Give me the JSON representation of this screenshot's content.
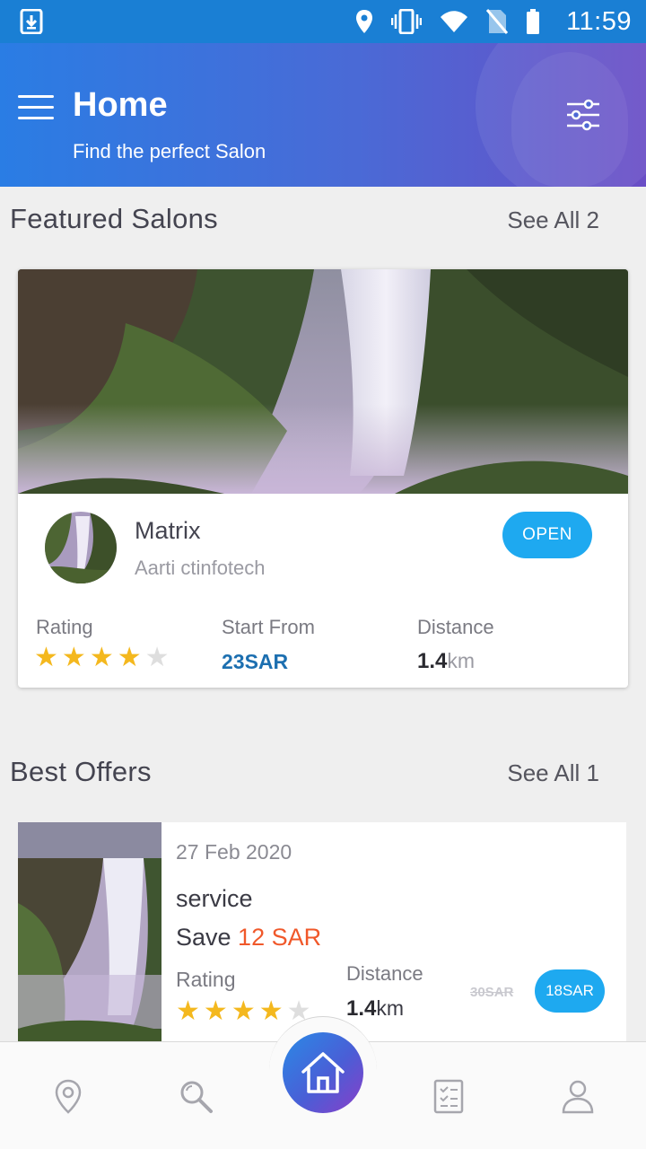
{
  "status_bar": {
    "time": "11:59"
  },
  "header": {
    "title": "Home",
    "subtitle": "Find the perfect Salon",
    "icons": [
      "menu-icon",
      "filter-sliders-icon"
    ]
  },
  "featured": {
    "section_title": "Featured Salons",
    "see_all": "See All 2",
    "salon": {
      "name": "Matrix",
      "owner": "Aarti ctinfotech",
      "status": "OPEN",
      "rating_label": "Rating",
      "rating": 4,
      "rating_max": 5,
      "start_label": "Start From",
      "start_price": "23SAR",
      "distance_label": "Distance",
      "distance_value": "1.4",
      "distance_unit": "km"
    }
  },
  "offers": {
    "section_title": "Best Offers",
    "see_all": "See All 1",
    "items": [
      {
        "date": "27 Feb 2020",
        "service": "service",
        "save_prefix": "Save ",
        "save_amount": "12 SAR",
        "rating_label": "Rating",
        "rating": 4,
        "rating_max": 5,
        "distance_label": "Distance",
        "distance_value": "1.4",
        "distance_unit": "km",
        "old_price": "30SAR",
        "new_price": "18SAR"
      }
    ]
  },
  "bottom_nav": {
    "items": [
      "location-icon",
      "search-icon",
      "home-icon",
      "bookings-list-icon",
      "profile-icon"
    ],
    "active": "home-icon"
  },
  "colors": {
    "accent": "#1ea9f0",
    "save": "#f0582a",
    "price": "#1c6fb0",
    "star": "#f4b81e"
  }
}
